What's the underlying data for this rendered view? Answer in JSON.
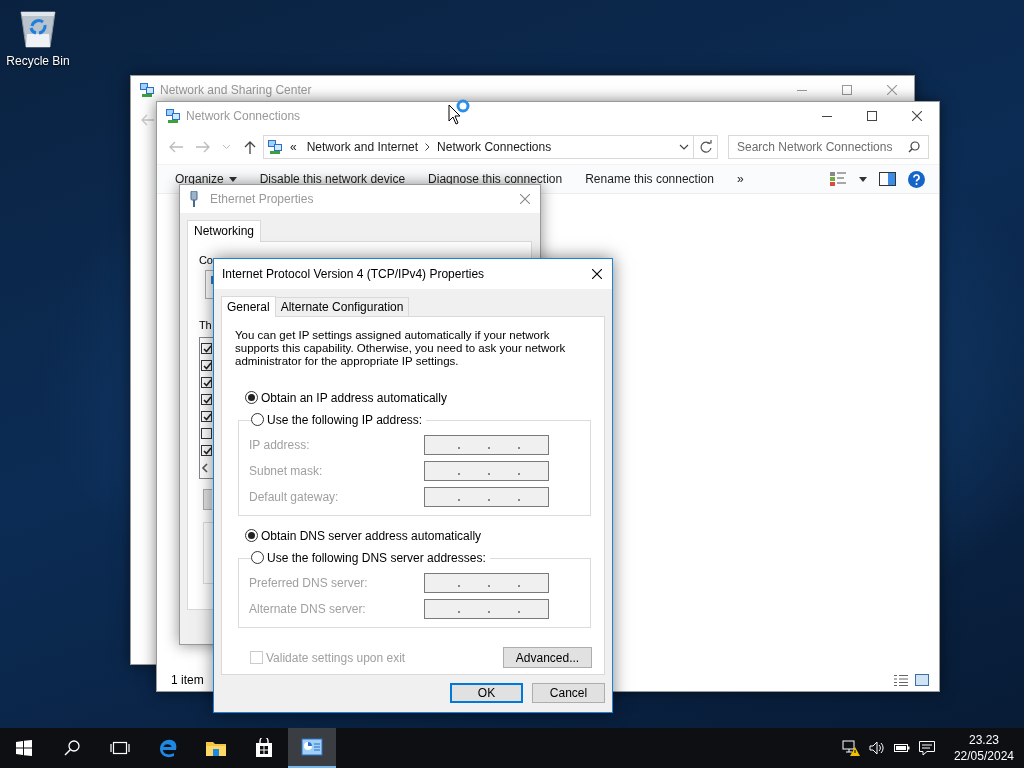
{
  "desktop_icons": [
    {
      "label": "Recycle Bin"
    }
  ],
  "sharing_center": {
    "title": "Network and Sharing Center"
  },
  "connections_window": {
    "title": "Network Connections",
    "breadcrumb": [
      "«",
      "Network and Internet",
      "Network Connections"
    ],
    "search": {
      "placeholder": "Search Network Connections"
    },
    "toolbar": [
      {
        "label": "Organize",
        "kind": "menu"
      },
      {
        "label": "Disable this network device",
        "kind": "command"
      },
      {
        "label": "Diagnose this connection",
        "kind": "command"
      },
      {
        "label": "Rename this connection",
        "kind": "command"
      },
      {
        "label": "»",
        "kind": "more"
      }
    ],
    "status": "1 item"
  },
  "ethernet_properties": {
    "title": "Ethernet Properties",
    "tabs": [
      {
        "label": "Networking",
        "selected": true
      }
    ],
    "labels": [
      "Co",
      "Th"
    ],
    "components": [
      {
        "checked": true
      },
      {
        "checked": true
      },
      {
        "checked": true
      },
      {
        "checked": true
      },
      {
        "checked": true
      },
      {
        "checked": false
      },
      {
        "checked": true
      }
    ]
  },
  "ipv4_dialog": {
    "title": "Internet Protocol Version 4 (TCP/IPv4) Properties",
    "tabs": [
      {
        "label": "General",
        "selected": true
      },
      {
        "label": "Alternate Configuration",
        "selected": false
      }
    ],
    "intro": "You can get IP settings assigned automatically if your network supports this capability. Otherwise, you need to ask your network administrator for the appropriate IP settings.",
    "ip_mode": [
      {
        "label": "Obtain an IP address automatically",
        "selected": true
      },
      {
        "label": "Use the following IP address:",
        "selected": false
      }
    ],
    "ip_fields": [
      {
        "label": "IP address:"
      },
      {
        "label": "Subnet mask:"
      },
      {
        "label": "Default gateway:"
      }
    ],
    "dns_mode": [
      {
        "label": "Obtain DNS server address automatically",
        "selected": true
      },
      {
        "label": "Use the following DNS server addresses:",
        "selected": false
      }
    ],
    "dns_fields": [
      {
        "label": "Preferred DNS server:"
      },
      {
        "label": "Alternate DNS server:"
      }
    ],
    "validate": {
      "label": "Validate settings upon exit",
      "checked": false,
      "disabled": true
    },
    "advanced_button": "Advanced...",
    "buttons": [
      {
        "label": "OK",
        "default": true
      },
      {
        "label": "Cancel",
        "default": false
      }
    ]
  },
  "taskbar": {
    "apps": [
      {
        "kind": "start",
        "selected": false
      },
      {
        "kind": "search",
        "selected": false
      },
      {
        "kind": "task-view",
        "selected": false
      },
      {
        "kind": "edge",
        "selected": false
      },
      {
        "kind": "explorer",
        "selected": false
      },
      {
        "kind": "store",
        "selected": false
      },
      {
        "kind": "network",
        "selected": true
      }
    ],
    "clock": {
      "time": "23.23",
      "date": "22/05/2024"
    }
  }
}
